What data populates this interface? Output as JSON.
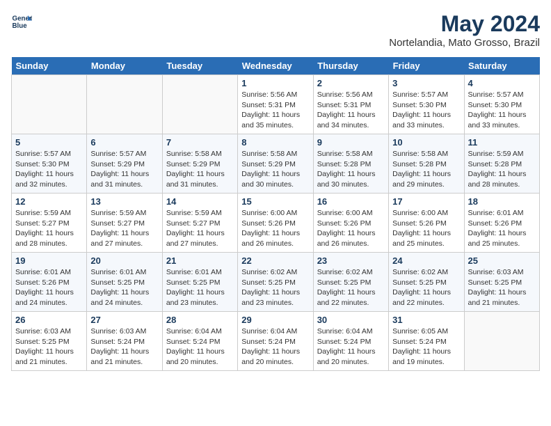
{
  "header": {
    "logo_line1": "General",
    "logo_line2": "Blue",
    "month_year": "May 2024",
    "location": "Nortelandia, Mato Grosso, Brazil"
  },
  "days_of_week": [
    "Sunday",
    "Monday",
    "Tuesday",
    "Wednesday",
    "Thursday",
    "Friday",
    "Saturday"
  ],
  "weeks": [
    [
      {
        "day": "",
        "info": ""
      },
      {
        "day": "",
        "info": ""
      },
      {
        "day": "",
        "info": ""
      },
      {
        "day": "1",
        "info": "Sunrise: 5:56 AM\nSunset: 5:31 PM\nDaylight: 11 hours\nand 35 minutes."
      },
      {
        "day": "2",
        "info": "Sunrise: 5:56 AM\nSunset: 5:31 PM\nDaylight: 11 hours\nand 34 minutes."
      },
      {
        "day": "3",
        "info": "Sunrise: 5:57 AM\nSunset: 5:30 PM\nDaylight: 11 hours\nand 33 minutes."
      },
      {
        "day": "4",
        "info": "Sunrise: 5:57 AM\nSunset: 5:30 PM\nDaylight: 11 hours\nand 33 minutes."
      }
    ],
    [
      {
        "day": "5",
        "info": "Sunrise: 5:57 AM\nSunset: 5:30 PM\nDaylight: 11 hours\nand 32 minutes."
      },
      {
        "day": "6",
        "info": "Sunrise: 5:57 AM\nSunset: 5:29 PM\nDaylight: 11 hours\nand 31 minutes."
      },
      {
        "day": "7",
        "info": "Sunrise: 5:58 AM\nSunset: 5:29 PM\nDaylight: 11 hours\nand 31 minutes."
      },
      {
        "day": "8",
        "info": "Sunrise: 5:58 AM\nSunset: 5:29 PM\nDaylight: 11 hours\nand 30 minutes."
      },
      {
        "day": "9",
        "info": "Sunrise: 5:58 AM\nSunset: 5:28 PM\nDaylight: 11 hours\nand 30 minutes."
      },
      {
        "day": "10",
        "info": "Sunrise: 5:58 AM\nSunset: 5:28 PM\nDaylight: 11 hours\nand 29 minutes."
      },
      {
        "day": "11",
        "info": "Sunrise: 5:59 AM\nSunset: 5:28 PM\nDaylight: 11 hours\nand 28 minutes."
      }
    ],
    [
      {
        "day": "12",
        "info": "Sunrise: 5:59 AM\nSunset: 5:27 PM\nDaylight: 11 hours\nand 28 minutes."
      },
      {
        "day": "13",
        "info": "Sunrise: 5:59 AM\nSunset: 5:27 PM\nDaylight: 11 hours\nand 27 minutes."
      },
      {
        "day": "14",
        "info": "Sunrise: 5:59 AM\nSunset: 5:27 PM\nDaylight: 11 hours\nand 27 minutes."
      },
      {
        "day": "15",
        "info": "Sunrise: 6:00 AM\nSunset: 5:26 PM\nDaylight: 11 hours\nand 26 minutes."
      },
      {
        "day": "16",
        "info": "Sunrise: 6:00 AM\nSunset: 5:26 PM\nDaylight: 11 hours\nand 26 minutes."
      },
      {
        "day": "17",
        "info": "Sunrise: 6:00 AM\nSunset: 5:26 PM\nDaylight: 11 hours\nand 25 minutes."
      },
      {
        "day": "18",
        "info": "Sunrise: 6:01 AM\nSunset: 5:26 PM\nDaylight: 11 hours\nand 25 minutes."
      }
    ],
    [
      {
        "day": "19",
        "info": "Sunrise: 6:01 AM\nSunset: 5:26 PM\nDaylight: 11 hours\nand 24 minutes."
      },
      {
        "day": "20",
        "info": "Sunrise: 6:01 AM\nSunset: 5:25 PM\nDaylight: 11 hours\nand 24 minutes."
      },
      {
        "day": "21",
        "info": "Sunrise: 6:01 AM\nSunset: 5:25 PM\nDaylight: 11 hours\nand 23 minutes."
      },
      {
        "day": "22",
        "info": "Sunrise: 6:02 AM\nSunset: 5:25 PM\nDaylight: 11 hours\nand 23 minutes."
      },
      {
        "day": "23",
        "info": "Sunrise: 6:02 AM\nSunset: 5:25 PM\nDaylight: 11 hours\nand 22 minutes."
      },
      {
        "day": "24",
        "info": "Sunrise: 6:02 AM\nSunset: 5:25 PM\nDaylight: 11 hours\nand 22 minutes."
      },
      {
        "day": "25",
        "info": "Sunrise: 6:03 AM\nSunset: 5:25 PM\nDaylight: 11 hours\nand 21 minutes."
      }
    ],
    [
      {
        "day": "26",
        "info": "Sunrise: 6:03 AM\nSunset: 5:25 PM\nDaylight: 11 hours\nand 21 minutes."
      },
      {
        "day": "27",
        "info": "Sunrise: 6:03 AM\nSunset: 5:24 PM\nDaylight: 11 hours\nand 21 minutes."
      },
      {
        "day": "28",
        "info": "Sunrise: 6:04 AM\nSunset: 5:24 PM\nDaylight: 11 hours\nand 20 minutes."
      },
      {
        "day": "29",
        "info": "Sunrise: 6:04 AM\nSunset: 5:24 PM\nDaylight: 11 hours\nand 20 minutes."
      },
      {
        "day": "30",
        "info": "Sunrise: 6:04 AM\nSunset: 5:24 PM\nDaylight: 11 hours\nand 20 minutes."
      },
      {
        "day": "31",
        "info": "Sunrise: 6:05 AM\nSunset: 5:24 PM\nDaylight: 11 hours\nand 19 minutes."
      },
      {
        "day": "",
        "info": ""
      }
    ]
  ]
}
